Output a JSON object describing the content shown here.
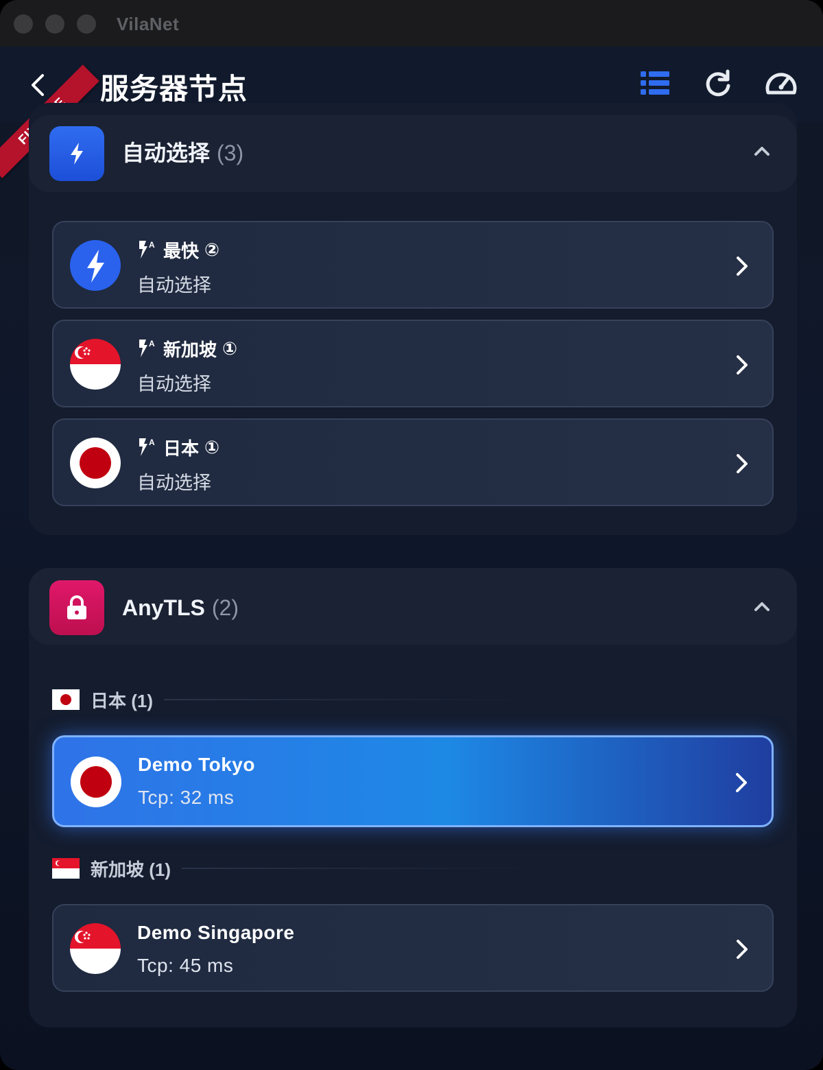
{
  "window": {
    "title": "VilaNet"
  },
  "header": {
    "title": "服务器节点",
    "ribbon": "FIXTURE"
  },
  "icons": {
    "back": "back-arrow-icon",
    "list": "list-icon",
    "refresh": "refresh-icon",
    "speed": "speedometer-icon"
  },
  "colors": {
    "accent": "#2f6cf0",
    "auto_group_icon": "#2563eb",
    "anytls_group_icon": "#d6155e",
    "active_node": "#2f73e8",
    "ribbon": "#b5122b"
  },
  "groups": [
    {
      "title": "自动选择",
      "count": "(3)",
      "icon": "lightning-icon",
      "nodes": [
        {
          "name": "最快",
          "badge": "②",
          "sub": "自动选择",
          "flag": "lightning"
        },
        {
          "name": "新加坡",
          "badge": "①",
          "sub": "自动选择",
          "flag": "singapore"
        },
        {
          "name": "日本",
          "badge": "①",
          "sub": "自动选择",
          "flag": "japan"
        }
      ]
    },
    {
      "title": "AnyTLS",
      "count": "(2)",
      "icon": "lock-icon",
      "sections": [
        {
          "label": "日本 (1)",
          "flag": "japan",
          "nodes": [
            {
              "name": "Demo Tokyo",
              "sub": "Tcp: 32 ms",
              "active": true
            }
          ]
        },
        {
          "label": "新加坡 (1)",
          "flag": "singapore",
          "nodes": [
            {
              "name": "Demo Singapore",
              "sub": "Tcp: 45 ms",
              "active": false
            }
          ]
        }
      ]
    }
  ]
}
